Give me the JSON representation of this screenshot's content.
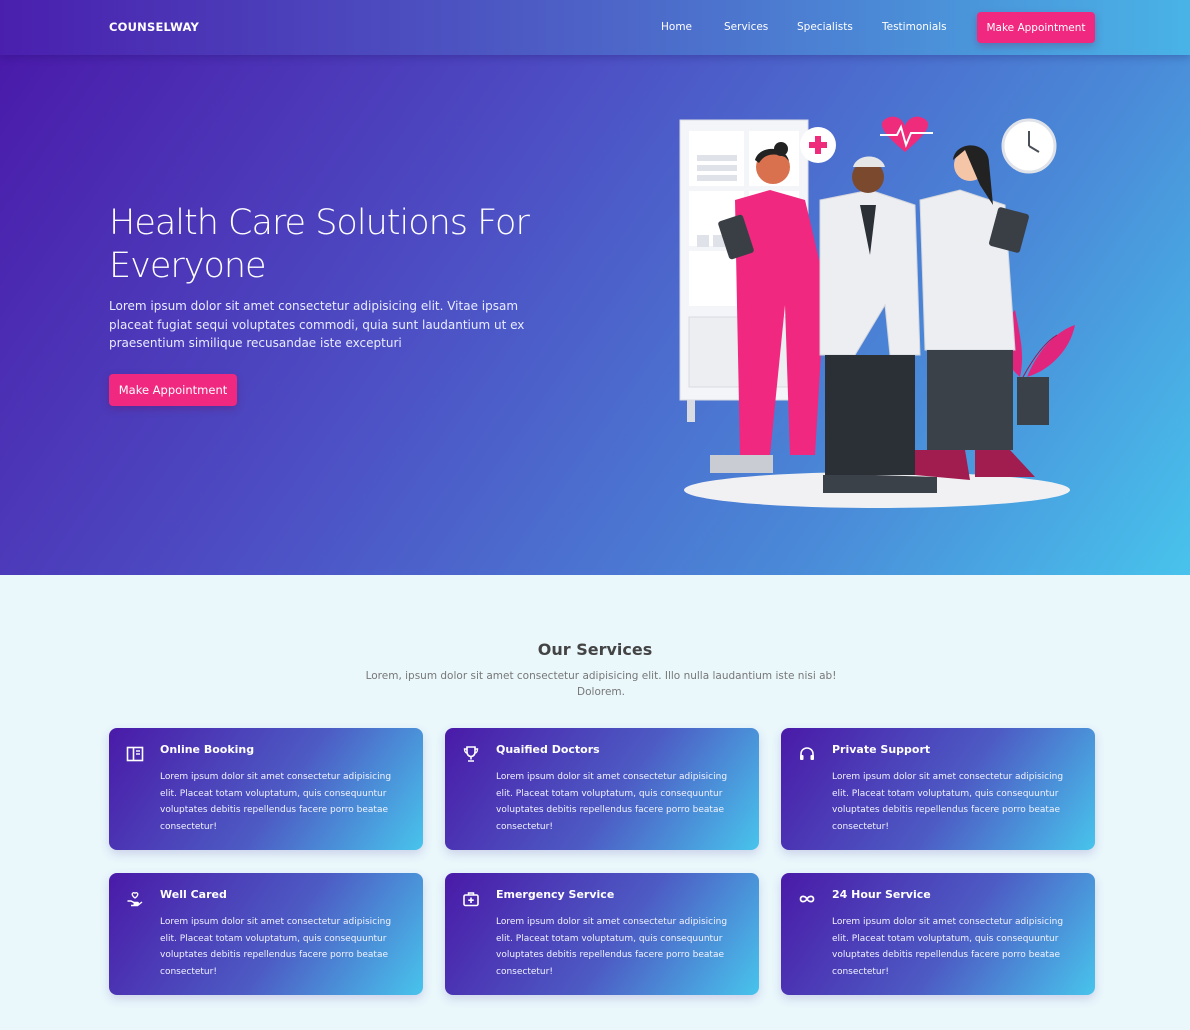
{
  "header": {
    "brand": "COUNSELWAY",
    "nav": [
      "Home",
      "Services",
      "Specialists",
      "Testimonials"
    ],
    "cta_label": "Make Appointment"
  },
  "hero": {
    "title": "Health Care Solutions For Everyone",
    "text": "Lorem ipsum dolor sit amet consectetur adipisicing elit. Vitae ipsam placeat fugiat sequi voluptates commodi, quia sunt laudantium ut ex praesentium similique recusandae iste excepturi",
    "cta_label": "Make Appointment"
  },
  "services": {
    "title": "Our Services",
    "subtitle": "Lorem, ipsum dolor sit amet consectetur adipisicing elit. Illo nulla laudantium iste nisi ab! Dolorem.",
    "items": [
      {
        "icon": "book-icon",
        "title": "Online Booking",
        "text": "Lorem ipsum dolor sit amet consectetur adipisicing elit. Placeat totam voluptatum, quis consequuntur voluptates debitis repellendus facere porro beatae consectetur!"
      },
      {
        "icon": "trophy-icon",
        "title": "Quaified Doctors",
        "text": "Lorem ipsum dolor sit amet consectetur adipisicing elit. Placeat totam voluptatum, quis consequuntur voluptates debitis repellendus facere porro beatae consectetur!"
      },
      {
        "icon": "headset-icon",
        "title": "Private Support",
        "text": "Lorem ipsum dolor sit amet consectetur adipisicing elit. Placeat totam voluptatum, quis consequuntur voluptates debitis repellendus facere porro beatae consectetur!"
      },
      {
        "icon": "hand-heart-icon",
        "title": "Well Cared",
        "text": "Lorem ipsum dolor sit amet consectetur adipisicing elit. Placeat totam voluptatum, quis consequuntur voluptates debitis repellendus facere porro beatae consectetur!"
      },
      {
        "icon": "first-aid-kit-icon",
        "title": "Emergency Service",
        "text": "Lorem ipsum dolor sit amet consectetur adipisicing elit. Placeat totam voluptatum, quis consequuntur voluptates debitis repellendus facere porro beatae consectetur!"
      },
      {
        "icon": "infinity-icon",
        "title": "24 Hour Service",
        "text": "Lorem ipsum dolor sit amet consectetur adipisicing elit. Placeat totam voluptatum, quis consequuntur voluptates debitis repellendus facere porro beatae consectetur!"
      }
    ]
  },
  "colors": {
    "accent": "#f0287f",
    "gradient_start": "#4a17a8",
    "gradient_end": "#48c3ec",
    "section_bg": "#eaf8fc"
  }
}
